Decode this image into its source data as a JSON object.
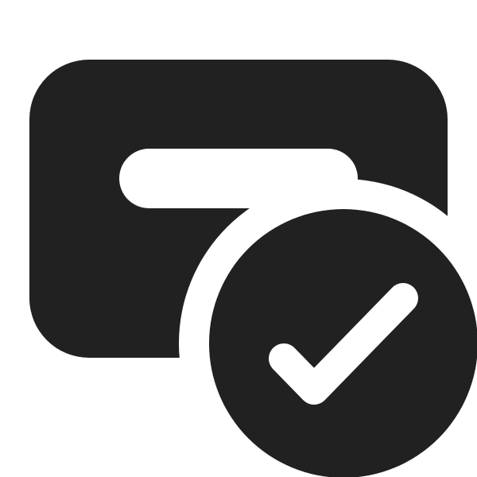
{
  "icon": {
    "name": "card-checkmark-icon",
    "color": "#212121",
    "background": "#ffffff",
    "parts": {
      "card": "card-icon",
      "badge": "checkmark-circle-icon",
      "check": "checkmark-icon",
      "bar": "card-bar"
    }
  }
}
